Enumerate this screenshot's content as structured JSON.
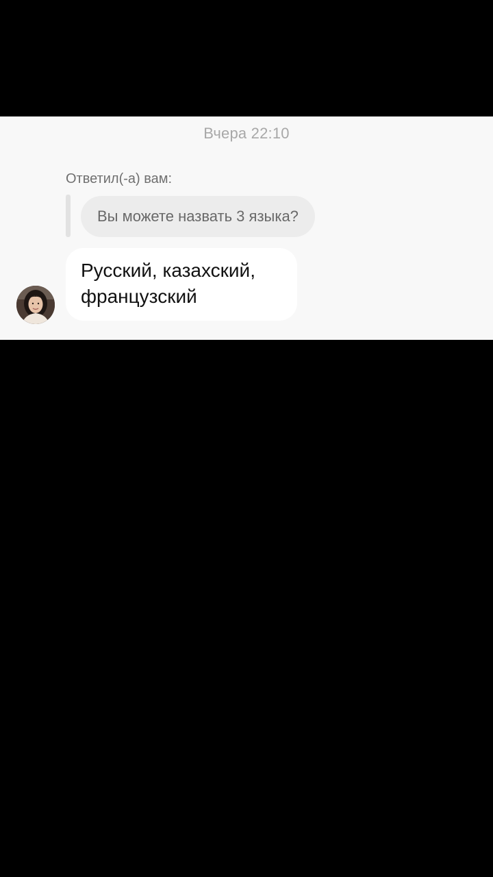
{
  "conversation": {
    "timestamp": "Вчера 22:10",
    "reply_label": "Ответил(-а) вам:",
    "quoted_message": "Вы можете назвать 3 языка?",
    "message_text": "Русский, казахский, французский",
    "avatar_icon": "user-photo-avatar"
  },
  "colors": {
    "panel_background": "#f8f8f8",
    "quoted_bubble": "#ececec",
    "message_bubble": "#ffffff",
    "letterbox": "#000000"
  }
}
